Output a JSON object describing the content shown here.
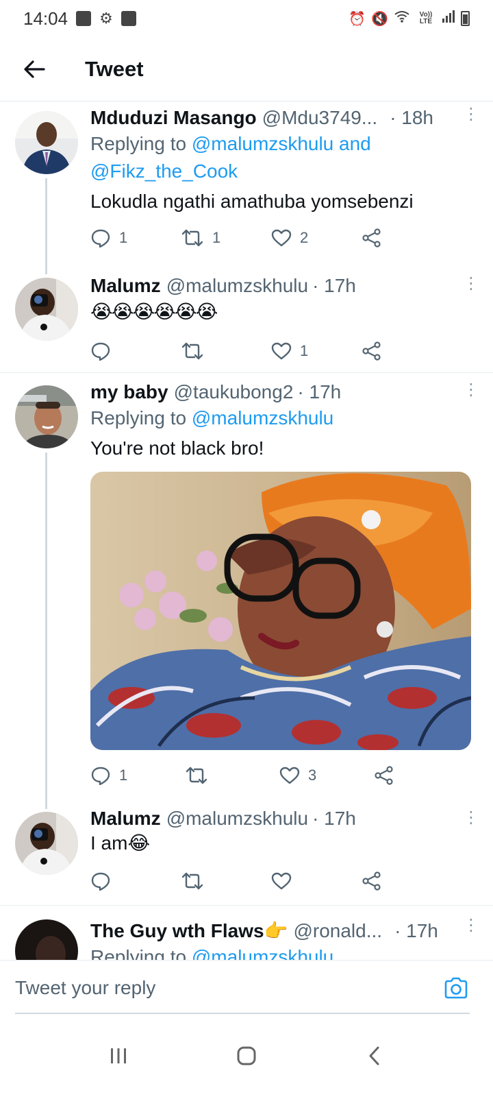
{
  "status_bar": {
    "time": "14:04",
    "network": "Vo)) LTE"
  },
  "header": {
    "title": "Tweet"
  },
  "tweets": [
    {
      "name": "Mduduzi Masango",
      "handle": "@Mdu3749...",
      "time": "· 18h",
      "replying_prefix": "Replying to ",
      "replying_users": "@malumzskhulu and @Fikz_the_Cook",
      "text": "Lokudla ngathi amathuba yomsebenzi",
      "reply_count": "1",
      "retweet_count": "1",
      "like_count": "2"
    },
    {
      "name": "Malumz",
      "handle": "@malumzskhulu",
      "time": "· 17h",
      "text": "😭😭😭😭😭😭",
      "reply_count": "",
      "retweet_count": "",
      "like_count": "1"
    },
    {
      "name": "my baby",
      "handle": "@taukubong2",
      "time": "· 17h",
      "replying_prefix": "Replying to ",
      "replying_users": "@malumzskhulu",
      "text": "You're not black bro!",
      "reply_count": "1",
      "retweet_count": "",
      "like_count": "3"
    },
    {
      "name": "Malumz",
      "handle": "@malumzskhulu",
      "time": "· 17h",
      "text": "I am😂",
      "reply_count": "",
      "retweet_count": "",
      "like_count": ""
    },
    {
      "name": "The Guy wth Flaws👉",
      "handle": "@ronald...",
      "time": "· 17h",
      "replying_prefix": "Replying to ",
      "replying_users": "@malumzskhulu"
    }
  ],
  "reply_bar": {
    "placeholder": "Tweet your reply"
  },
  "colors": {
    "accent": "#1d9bf0",
    "secondary_text": "#536471",
    "divider": "#e6ecf0"
  }
}
